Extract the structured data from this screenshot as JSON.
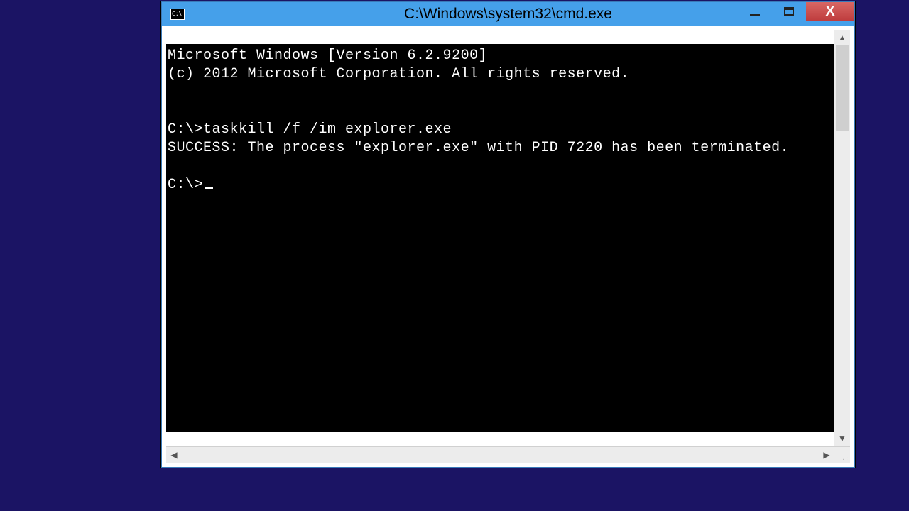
{
  "window": {
    "title": "C:\\Windows\\system32\\cmd.exe"
  },
  "console": {
    "lines": [
      "Microsoft Windows [Version 6.2.9200]",
      "(c) 2012 Microsoft Corporation. All rights reserved.",
      "",
      "",
      "C:\\>taskkill /f /im explorer.exe",
      "SUCCESS: The process \"explorer.exe\" with PID 7220 has been terminated.",
      ""
    ],
    "prompt": "C:\\>"
  },
  "glyphs": {
    "close": "X",
    "up": "▲",
    "down": "▼",
    "left": "◀",
    "right": "▶",
    "grip": ".:"
  }
}
